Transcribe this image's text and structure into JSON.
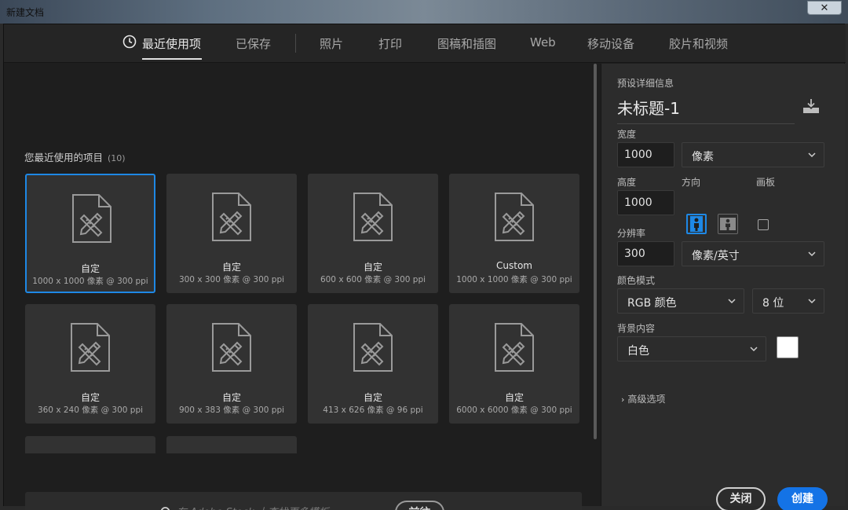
{
  "window": {
    "title": "新建文档",
    "close_glyph": "✕"
  },
  "nav": {
    "tabs": [
      {
        "label": "最近使用项",
        "active": true,
        "icon": "clock-icon"
      },
      {
        "label": "已保存"
      },
      {
        "label": "照片"
      },
      {
        "label": "打印"
      },
      {
        "label": "图稿和插图"
      },
      {
        "label": "Web"
      },
      {
        "label": "移动设备"
      },
      {
        "label": "胶片和视频"
      }
    ]
  },
  "recent": {
    "title": "您最近使用的项目",
    "count": "(10)",
    "items": [
      {
        "name": "自定",
        "size": "1000 x 1000 像素 @ 300 ppi",
        "selected": true
      },
      {
        "name": "自定",
        "size": "300 x 300 像素 @ 300 ppi"
      },
      {
        "name": "自定",
        "size": "600 x 600 像素 @ 300 ppi"
      },
      {
        "name": "Custom",
        "size": "1000 x 1000 像素 @ 300 ppi"
      },
      {
        "name": "自定",
        "size": "360 x 240 像素 @ 300 ppi"
      },
      {
        "name": "自定",
        "size": "900 x 383 像素 @ 300 ppi"
      },
      {
        "name": "自定",
        "size": "413 x 626 像素 @ 96 ppi"
      },
      {
        "name": "自定",
        "size": "6000 x 6000 像素 @ 300 ppi"
      }
    ]
  },
  "stock": {
    "placeholder": "在 Adobe Stock 上查找更多模板",
    "go_label": "前往"
  },
  "preset": {
    "section_label": "预设详细信息",
    "doc_name": "未标题-1",
    "width_label": "宽度",
    "width_value": "1000",
    "width_unit": "像素",
    "height_label": "高度",
    "height_value": "1000",
    "orientation_label": "方向",
    "artboard_label": "画板",
    "resolution_label": "分辨率",
    "resolution_value": "300",
    "resolution_unit": "像素/英寸",
    "color_mode_label": "颜色模式",
    "color_mode_value": "RGB 颜色",
    "bit_depth": "8 位",
    "background_label": "背景内容",
    "background_value": "白色",
    "background_color": "#ffffff",
    "advanced_label": "高级选项",
    "close_label": "关闭",
    "create_label": "创建"
  },
  "colors": {
    "accent": "#1473e6",
    "selection": "#1e88e5"
  }
}
